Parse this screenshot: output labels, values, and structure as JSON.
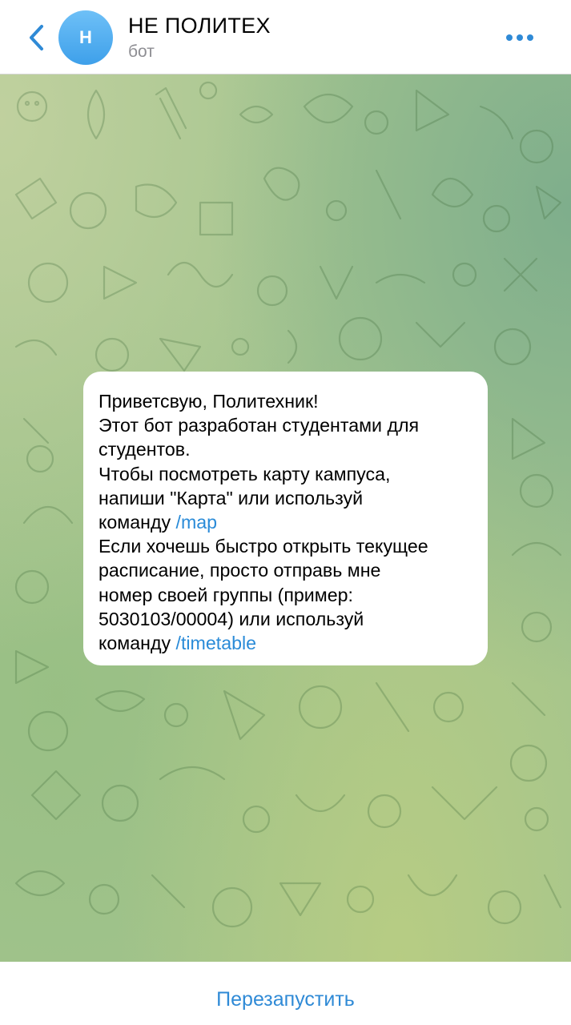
{
  "header": {
    "back_icon": "chevron-left-icon",
    "avatar_letter": "Н",
    "avatar_colors": [
      "#6ec0f7",
      "#3ea0ea"
    ],
    "title": "НЕ ПОЛИТЕХ",
    "subtitle": "бот",
    "more_icon": "ellipsis-icon"
  },
  "message": {
    "lines": [
      "Приветсвую, Политехник!",
      "Этот бот разработан студентами для",
      "студентов.",
      "Чтобы посмотреть карту кампуса,",
      "напиши \"Карта\" или используй"
    ],
    "map_prefix": "команду ",
    "map_command": "/map",
    "lines2": [
      "Если хочешь быстро открыть текущее",
      "расписание, просто отправь мне",
      "номер своей группы (пример:",
      "5030103/00004) или используй"
    ],
    "timetable_prefix": "команду ",
    "timetable_command": "/timetable"
  },
  "bottom": {
    "restart_label": "Перезапустить"
  },
  "colors": {
    "accent": "#2f8ad6",
    "chat_background": "#a3c48e"
  }
}
